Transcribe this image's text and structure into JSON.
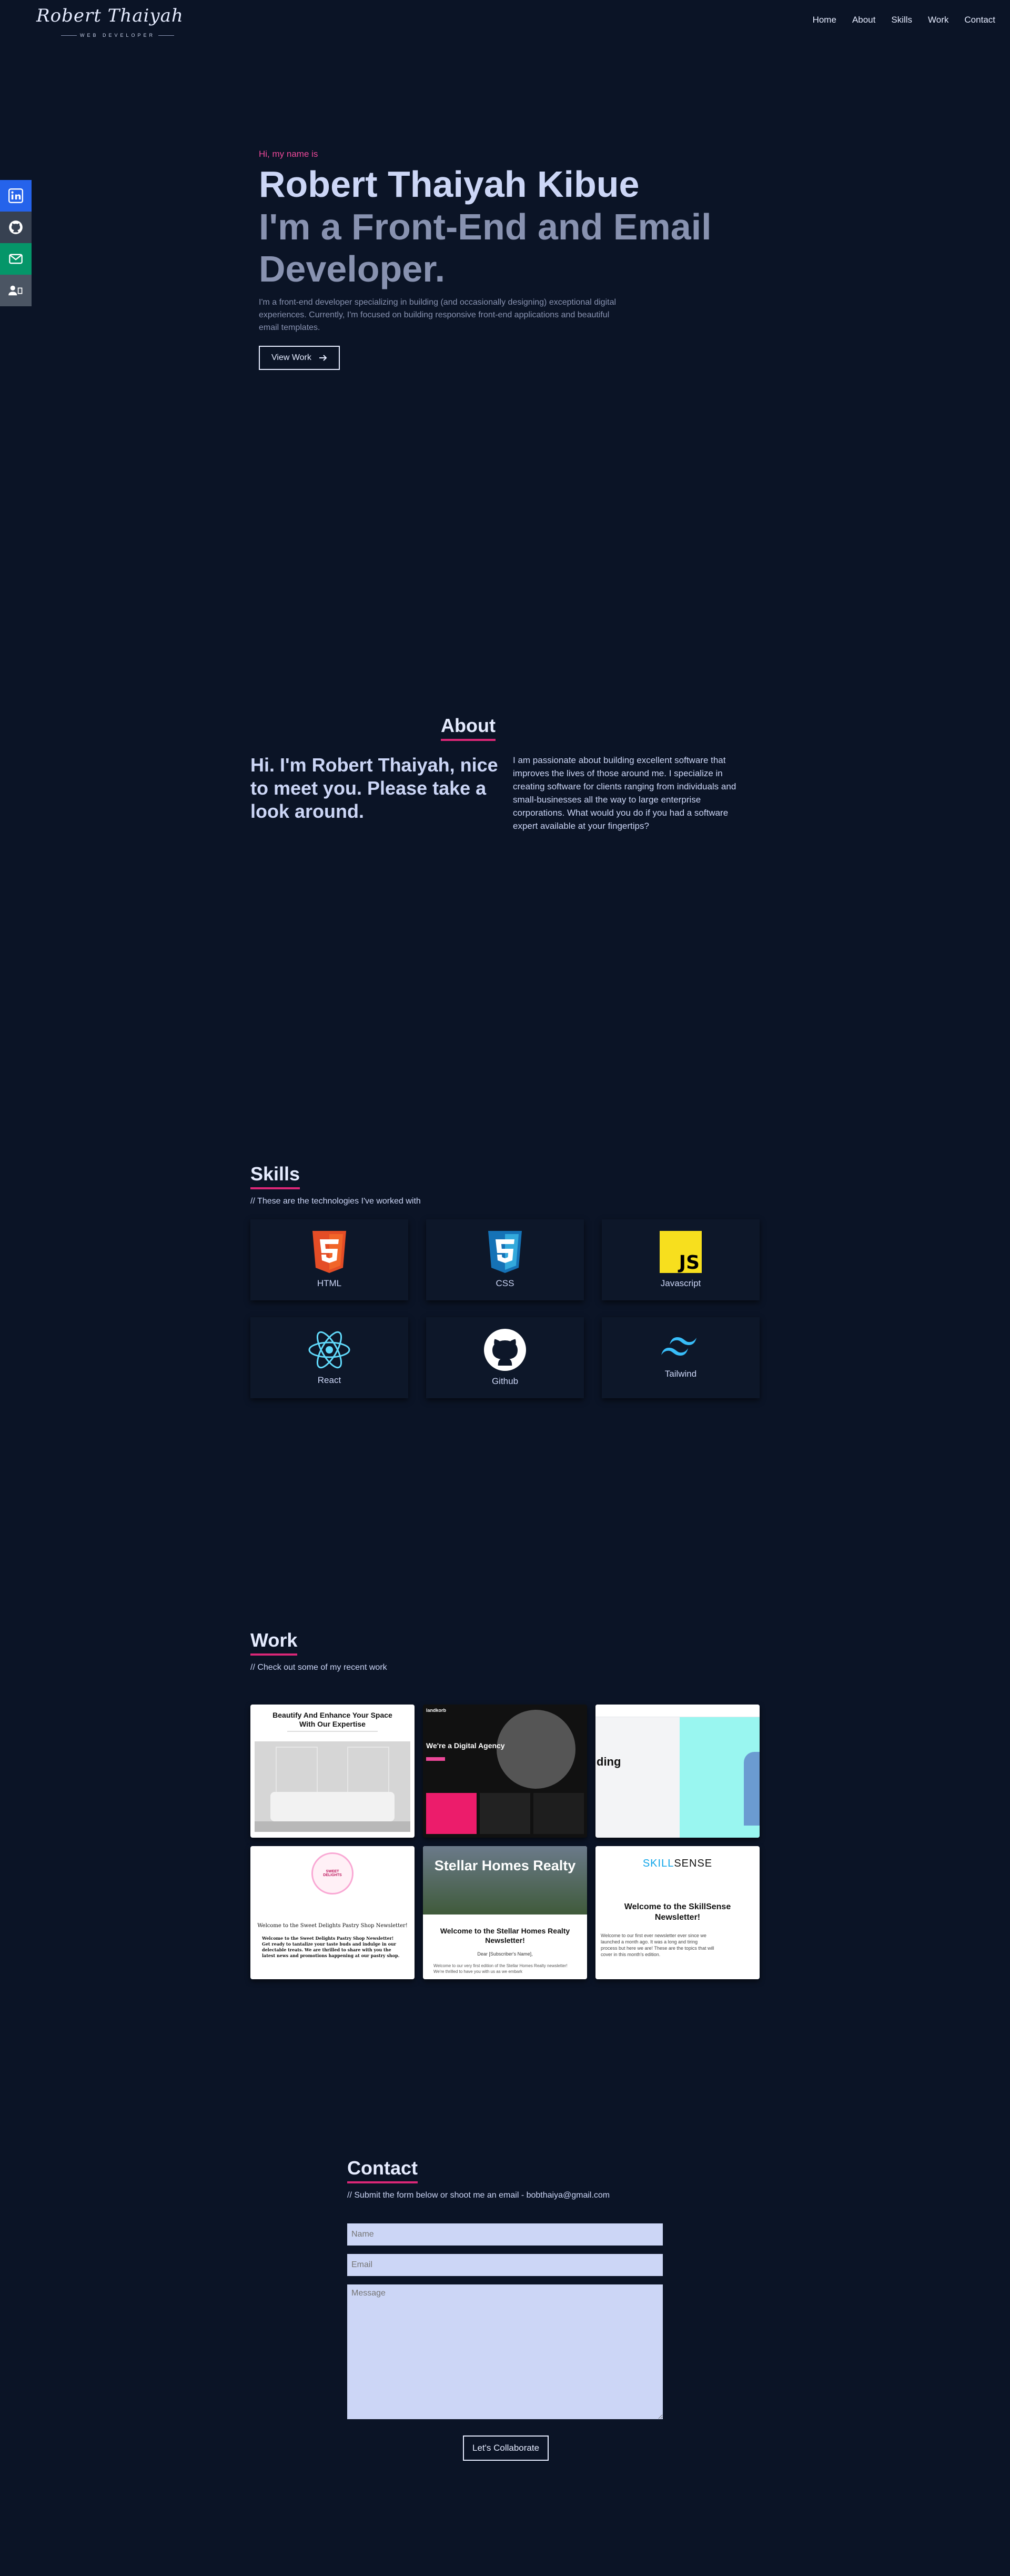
{
  "logo": {
    "signature": "Robert Thaiyah",
    "subtitle": "WEB DEVELOPER"
  },
  "nav": {
    "items": [
      "Home",
      "About",
      "Skills",
      "Work",
      "Contact"
    ]
  },
  "social": {
    "icons": [
      "linkedin-icon",
      "github-icon",
      "mail-icon",
      "resume-icon"
    ],
    "colors": [
      "#2563eb",
      "#374151",
      "#059669",
      "#4b5563"
    ]
  },
  "hero": {
    "greeting": "Hi, my name is",
    "name": "Robert Thaiyah Kibue",
    "title": "I'm a Front-End and Email Developer.",
    "intro": "I'm a front-end developer specializing in building (and occasionally designing) exceptional digital experiences. Currently, I'm focused on building responsive front-end applications and beautiful email templates.",
    "button": "View Work"
  },
  "about": {
    "title": "About",
    "heading": "Hi. I'm Robert Thaiyah, nice to meet you. Please take a look around.",
    "body": "I am passionate about building excellent software that improves the lives of those around me. I specialize in creating software for clients ranging from individuals and small-businesses all the way to large enterprise corporations. What would you do if you had a software expert available at your fingertips?"
  },
  "skills": {
    "title": "Skills",
    "subtitle": "// These are the technologies I've worked with",
    "items": [
      {
        "label": "HTML",
        "icon": "html5-icon"
      },
      {
        "label": "CSS",
        "icon": "css3-icon"
      },
      {
        "label": "Javascript",
        "icon": "javascript-icon"
      },
      {
        "label": "React",
        "icon": "react-icon"
      },
      {
        "label": "Github",
        "icon": "github-icon"
      },
      {
        "label": "Tailwind",
        "icon": "tailwind-icon"
      }
    ]
  },
  "work": {
    "title": "Work",
    "subtitle": "// Check out some of my recent work",
    "cards": [
      {
        "headline": "Beautify And Enhance Your Space With Our Expertise"
      },
      {
        "brand": "landkorb",
        "headline": "We're a Digital Agency"
      },
      {
        "headline": "ding"
      },
      {
        "badge": "SWEET DELIGHTS",
        "headline": "Welcome to the Sweet Delights Pastry Shop Newsletter!",
        "body": "Welcome to the Sweet Delights Pastry Shop Newsletter! Get ready to tantalize your taste buds and indulge in our delectable treats. We are thrilled to share with you the latest news and promotions happening at our pastry shop."
      },
      {
        "banner": "Stellar Homes Realty",
        "headline": "Welcome to the Stellar Homes Realty Newsletter!",
        "greeting": "Dear [Subscriber's Name],",
        "body": "Welcome to our very first edition of the Stellar Homes Realty newsletter! We're thrilled to have you with us as we embark"
      },
      {
        "brand_a": "SKILL",
        "brand_b": "SENSE",
        "headline": "Welcome to the SkillSense Newsletter!",
        "body": "Welcome to our first ever newsletter ever since we launched a month ago. It was a long and tiring process but here we are! These are the topics that will cover in this month's edition."
      }
    ]
  },
  "contact": {
    "title": "Contact",
    "subtitle": "// Submit the form below or shoot me an email - bobthaiya@gmail.com",
    "name_placeholder": "Name",
    "email_placeholder": "Email",
    "message_placeholder": "Message",
    "button": "Let's Collaborate"
  },
  "colors": {
    "background": "#0b1426",
    "accent": "#db2777",
    "text": "#ccd6f6",
    "muted": "#8892b0"
  }
}
